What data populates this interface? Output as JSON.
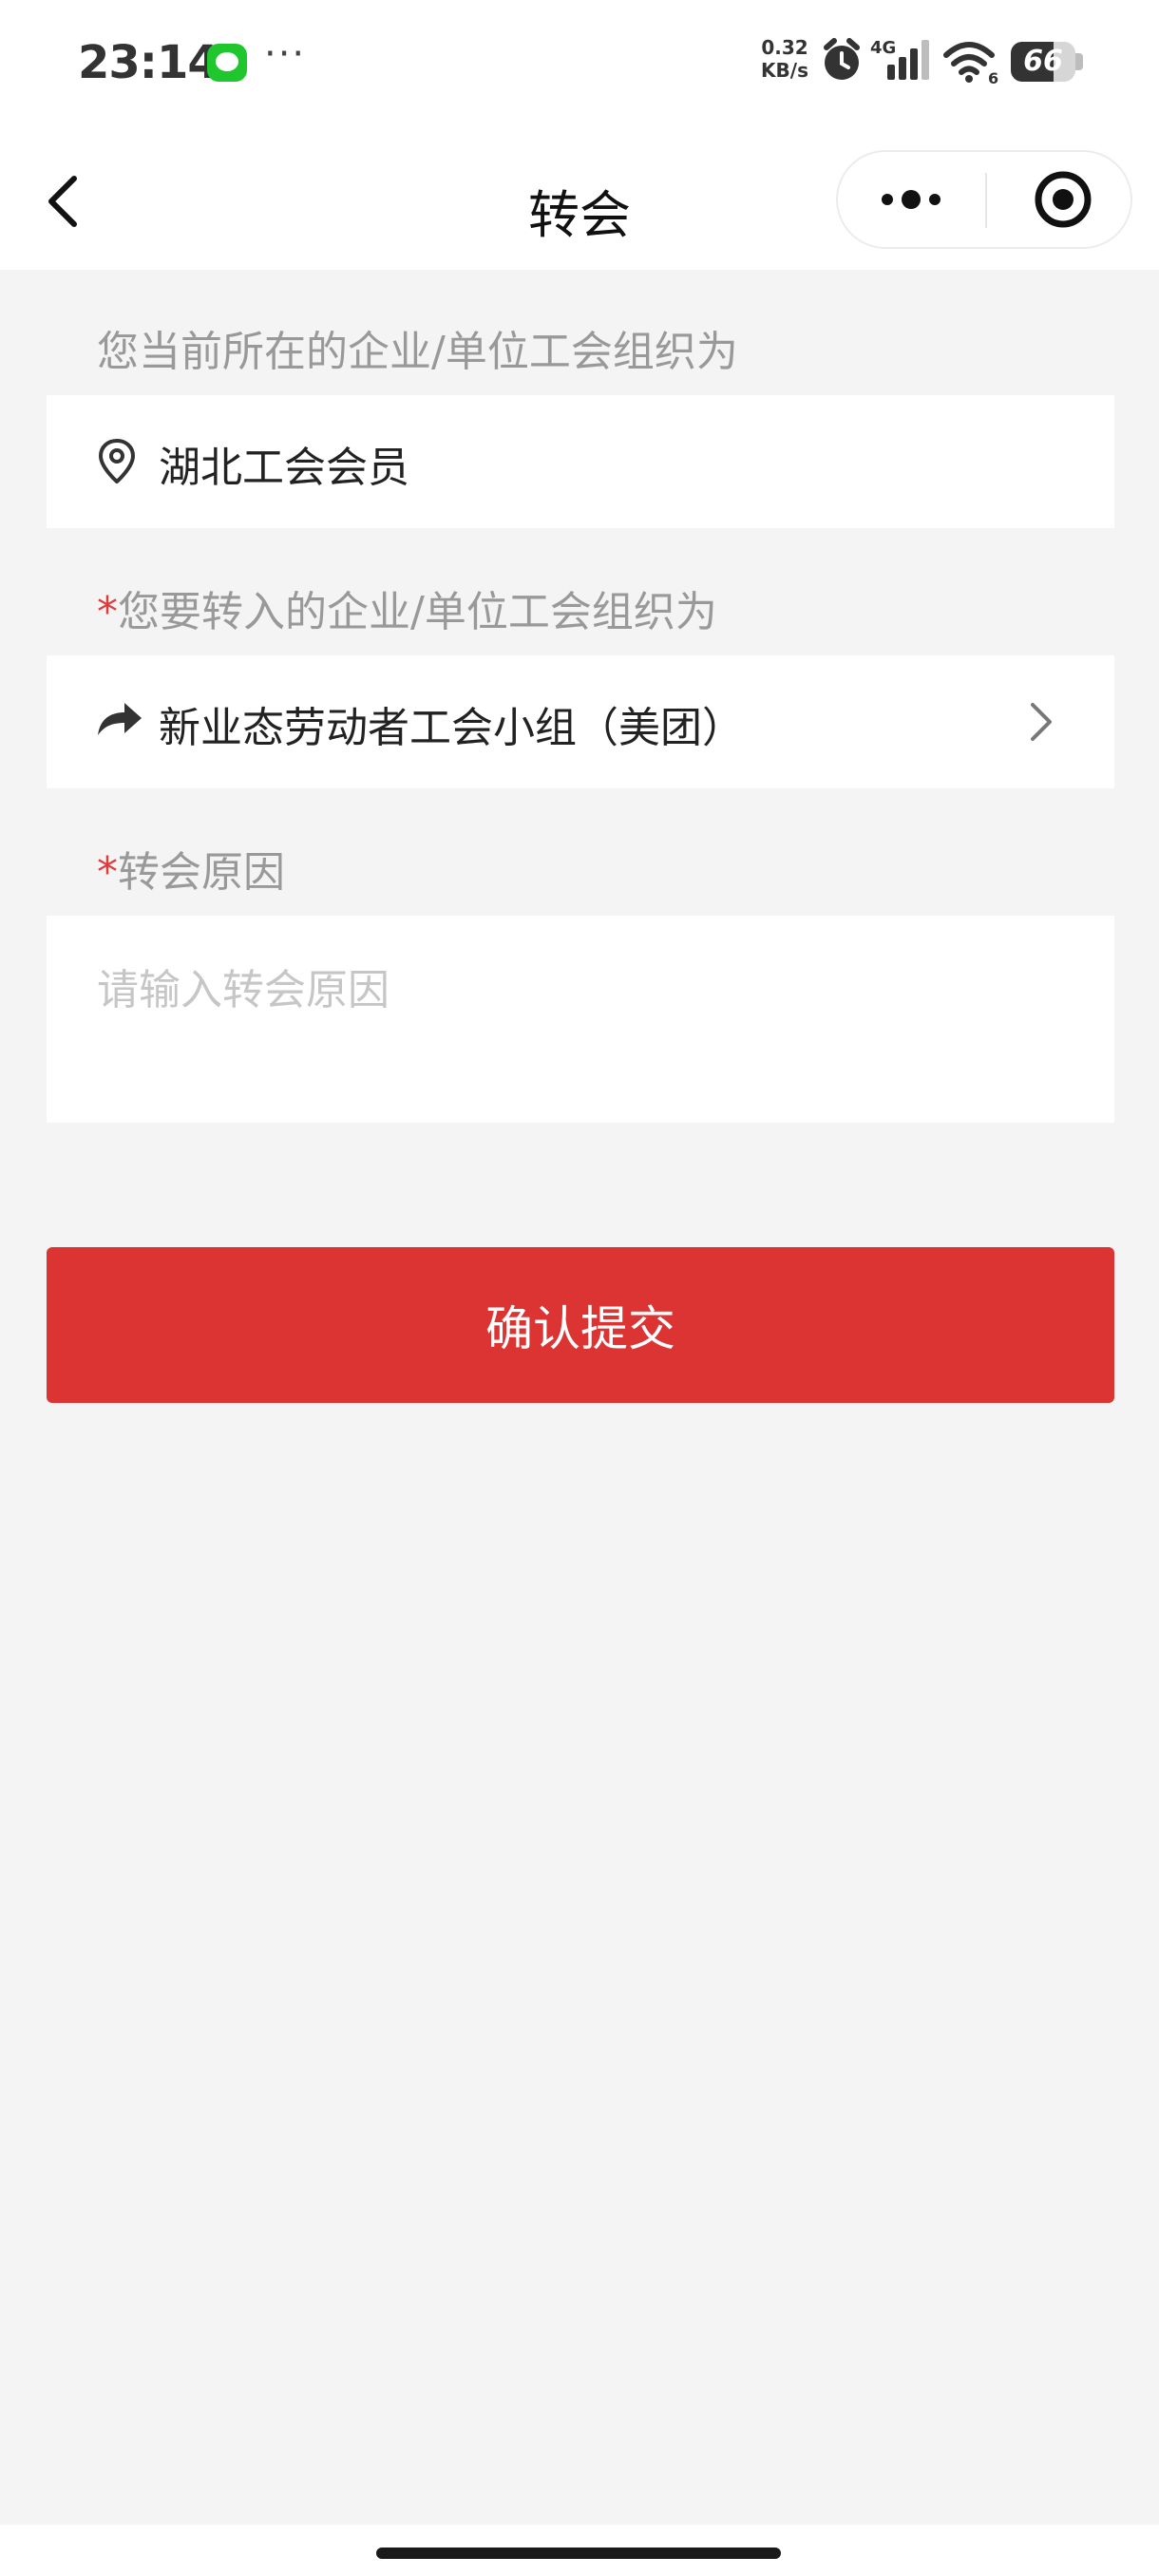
{
  "status_bar": {
    "time": "23:14",
    "more": "···",
    "net_speed_value": "0.32",
    "net_speed_unit": "KB/s",
    "network_type": "4G",
    "wifi_badge": "6",
    "battery_level": "66",
    "icons": [
      "message-icon",
      "alarm-icon",
      "signal-icon",
      "wifi-icon",
      "battery-icon"
    ]
  },
  "nav": {
    "title": "转会",
    "icons": [
      "back-icon",
      "more-icon",
      "close-mini-program-icon"
    ]
  },
  "form": {
    "current_org_label": "您当前所在的企业/单位工会组织为",
    "current_org_value": "湖北工会会员",
    "target_org_required": "*",
    "target_org_label": "您要转入的企业/单位工会组织为",
    "target_org_value": "新业态劳动者工会小组（美团）",
    "reason_required": "*",
    "reason_label": "转会原因",
    "reason_placeholder": "请输入转会原因",
    "reason_value": ""
  },
  "actions": {
    "submit_label": "确认提交"
  },
  "colors": {
    "accent": "#dc3333",
    "required_star": "#e03a3a",
    "background": "#f4f4f4",
    "label_gray": "#999999"
  }
}
